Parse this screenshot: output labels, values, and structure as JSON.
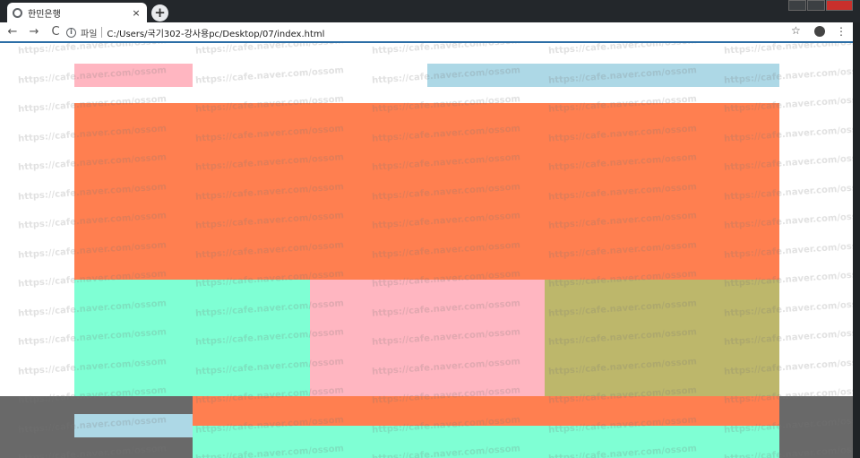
{
  "browser": {
    "tab_title": "한민은행",
    "tab_close": "×",
    "new_tab": "+",
    "back": "←",
    "forward": "→",
    "reload": "C",
    "scheme_label": "파일",
    "url": "C:/Users/국기302-강사용pc/Desktop/07/index.html",
    "star": "☆",
    "menu": "⋮",
    "info": "i"
  },
  "watermark": "https://cafe.naver.com/ossom",
  "colors": {
    "pink": "#ffb6c1",
    "lightblue": "#add8e6",
    "coral": "#ff7f50",
    "aquamarine": "#7fffd4",
    "khaki": "#bdb76b",
    "shade": "#696969"
  }
}
